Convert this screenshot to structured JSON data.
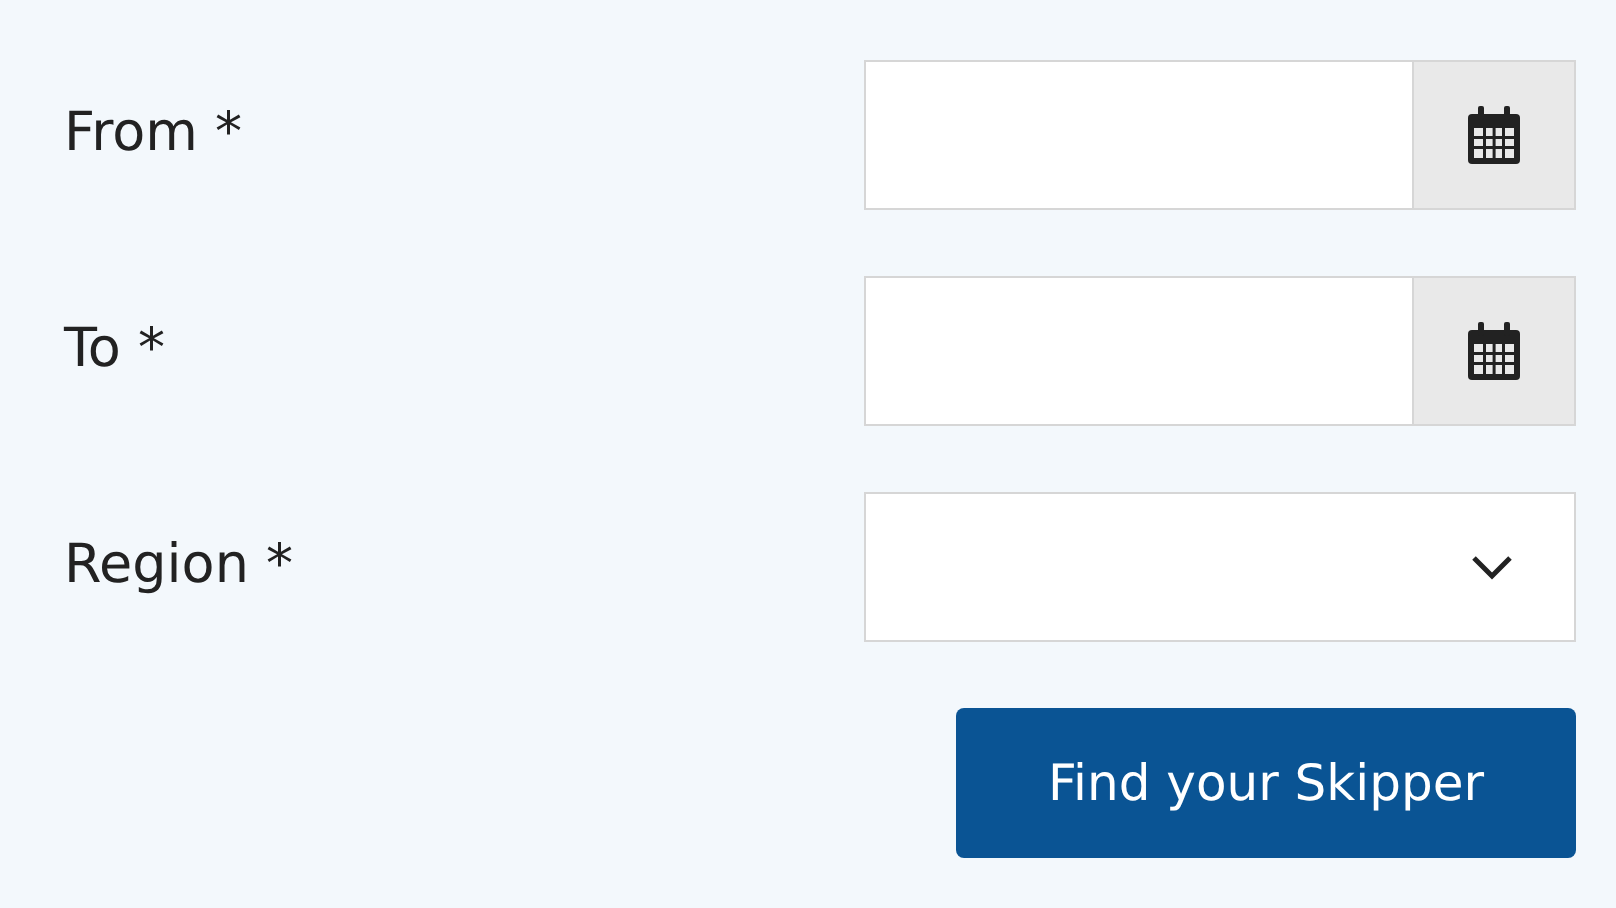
{
  "fields": [
    {
      "label": "From *",
      "kind": "date"
    },
    {
      "label": "To *",
      "kind": "date"
    },
    {
      "label": "Region *",
      "kind": "select"
    }
  ],
  "submit": {
    "label": "Find your Skipper"
  }
}
